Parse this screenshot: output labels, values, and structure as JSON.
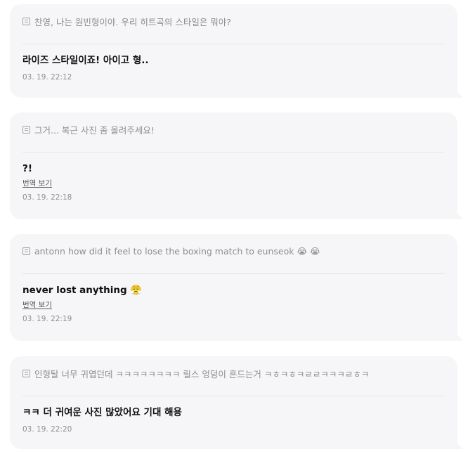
{
  "messages": [
    {
      "quote_text": "찬영, 나는 원빈형이야. 우리 히트곡의 스타일은 뭐야?",
      "reply_text": "라이즈 스타일이죠! 아이고 형..",
      "translate_label": "",
      "timestamp": "03. 19. 22:12"
    },
    {
      "quote_text": "그거... 복근 사진 좀 올려주세요!",
      "reply_text": "?!",
      "translate_label": "번역 보기",
      "timestamp": "03. 19. 22:18"
    },
    {
      "quote_text": "antonn how did it feel to lose the boxing match to eunseok 😭 😭",
      "reply_text": "never lost anything 😤",
      "translate_label": "번역 보기",
      "timestamp": "03. 19. 22:19"
    },
    {
      "quote_text": "인형탈 너무 귀엽던데 ㅋㅋㅋㅋㅋㅋㅋㅋ 릴스 엉덩이 흔드는거 ㅋㅎㅋㅎㅋㄹㄹㅋㅋㅋㄹㅎㅋ",
      "reply_text": "ㅋㅋ 더 귀여운 사진 많았어요 기대 해용",
      "translate_label": "",
      "timestamp": "03. 19. 22:20"
    }
  ]
}
